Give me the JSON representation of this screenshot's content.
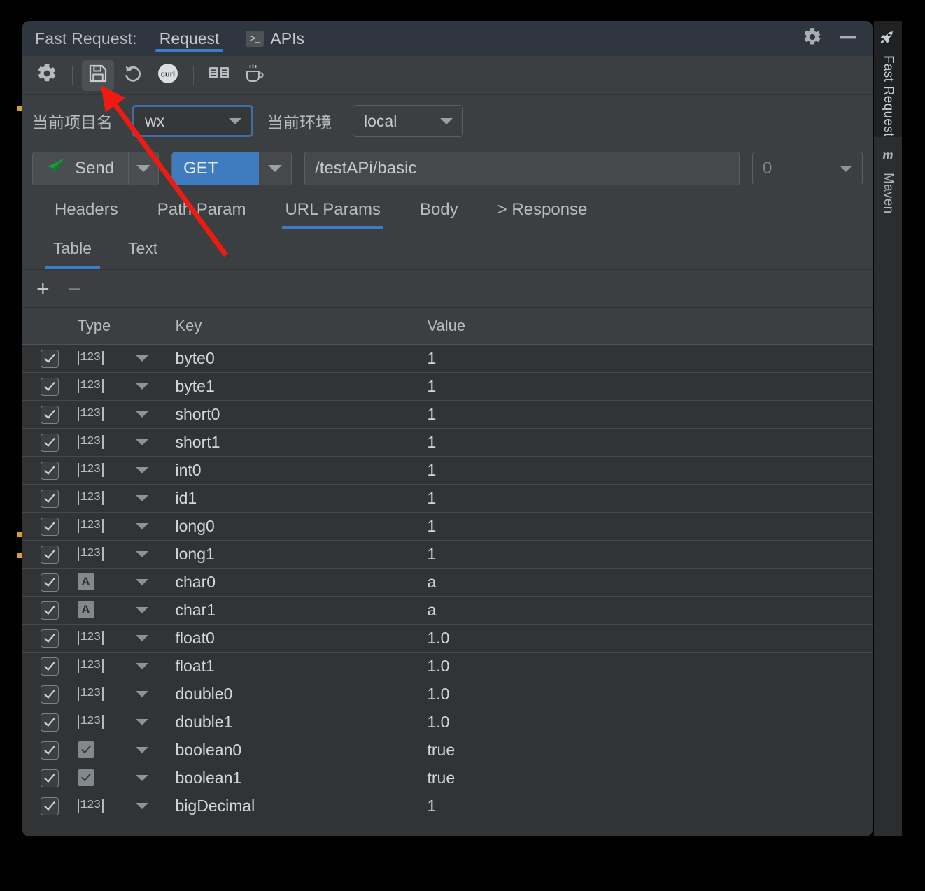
{
  "window": {
    "title": "Fast Request:",
    "tabs": [
      {
        "label": "Request",
        "icon": "",
        "selected": true
      },
      {
        "label": "APIs",
        "icon": "terminal-icon",
        "selected": false
      }
    ],
    "controls": [
      {
        "name": "settings-gear",
        "icon": "gear-icon"
      },
      {
        "name": "hide-panel",
        "icon": "minimize-icon"
      }
    ]
  },
  "toolbar": {
    "buttons": [
      {
        "name": "settings",
        "icon": "gear-icon",
        "active": false
      },
      {
        "name": "save",
        "icon": "floppy-save-icon",
        "active": true
      },
      {
        "name": "reset",
        "icon": "undo-refresh-icon",
        "active": false
      },
      {
        "name": "curl",
        "icon": "curl-icon",
        "label": "curl",
        "active": false
      },
      {
        "name": "docs",
        "icon": "book-icon",
        "active": false
      },
      {
        "name": "coffee",
        "icon": "coffee-cup-icon",
        "active": false
      }
    ]
  },
  "env": {
    "project_label": "当前项目名",
    "project_value": "wx",
    "environment_label": "当前环境",
    "environment_value": "local"
  },
  "request": {
    "send_label": "Send",
    "method": "GET",
    "url": "/testAPi/basic",
    "port_placeholder": "0"
  },
  "main_tabs": [
    {
      "label": "Headers",
      "selected": false
    },
    {
      "label": "Path Param",
      "selected": false
    },
    {
      "label": "URL Params",
      "selected": true
    },
    {
      "label": "Body",
      "selected": false
    },
    {
      "label": "> Response",
      "selected": false
    }
  ],
  "sub_tabs": [
    {
      "label": "Table",
      "selected": true
    },
    {
      "label": "Text",
      "selected": false
    }
  ],
  "table_actions": {
    "add": "+",
    "remove": "−"
  },
  "table": {
    "columns": [
      "",
      "Type",
      "Key",
      "Value"
    ],
    "rows": [
      {
        "checked": true,
        "type": "number",
        "key": "byte0",
        "value": "1"
      },
      {
        "checked": true,
        "type": "number",
        "key": "byte1",
        "value": "1"
      },
      {
        "checked": true,
        "type": "number",
        "key": "short0",
        "value": "1"
      },
      {
        "checked": true,
        "type": "number",
        "key": "short1",
        "value": "1"
      },
      {
        "checked": true,
        "type": "number",
        "key": "int0",
        "value": "1"
      },
      {
        "checked": true,
        "type": "number",
        "key": "id1",
        "value": "1"
      },
      {
        "checked": true,
        "type": "number",
        "key": "long0",
        "value": "1"
      },
      {
        "checked": true,
        "type": "number",
        "key": "long1",
        "value": "1"
      },
      {
        "checked": true,
        "type": "string",
        "key": "char0",
        "value": "a"
      },
      {
        "checked": true,
        "type": "string",
        "key": "char1",
        "value": "a"
      },
      {
        "checked": true,
        "type": "number",
        "key": "float0",
        "value": "1.0"
      },
      {
        "checked": true,
        "type": "number",
        "key": "float1",
        "value": "1.0"
      },
      {
        "checked": true,
        "type": "number",
        "key": "double0",
        "value": "1.0"
      },
      {
        "checked": true,
        "type": "number",
        "key": "double1",
        "value": "1.0"
      },
      {
        "checked": true,
        "type": "boolean",
        "key": "boolean0",
        "value": "true"
      },
      {
        "checked": true,
        "type": "boolean",
        "key": "boolean1",
        "value": "true"
      },
      {
        "checked": true,
        "type": "number",
        "key": "bigDecimal",
        "value": "1"
      }
    ]
  },
  "sidebar": {
    "items": [
      {
        "label": "Fast Request",
        "icon": "rocket-icon",
        "selected": true
      },
      {
        "label": "Maven",
        "icon": "maven-m-icon",
        "selected": false
      }
    ]
  },
  "annotation": {
    "type": "arrow",
    "color": "#f01a12",
    "points_to": "save-button"
  },
  "colors": {
    "accent_blue": "#3d7cc9",
    "method_blue": "#3f7cbf",
    "send_green": "#199b3c",
    "panel_bg": "#3c3f41",
    "table_bg": "#313335",
    "titlebar_bg": "#2f3640",
    "marker_orange": "#d8a22a"
  }
}
